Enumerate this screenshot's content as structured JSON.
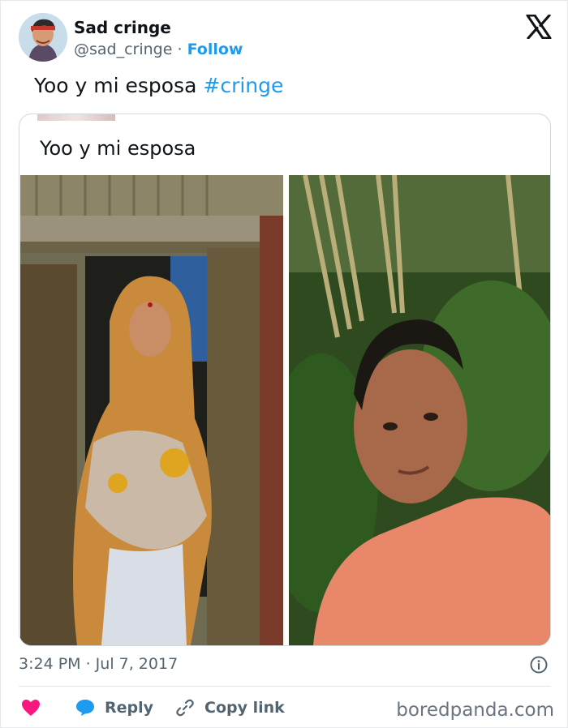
{
  "author": {
    "display_name": "Sad cringe",
    "handle": "@sad_cringe",
    "separator": "·",
    "follow_label": "Follow"
  },
  "tweet": {
    "text": "Yoo y mi esposa",
    "hashtag": "#cringe"
  },
  "quoted": {
    "text": "Yoo y mi esposa"
  },
  "meta": {
    "timestamp": "3:24 PM · Jul 7, 2017"
  },
  "actions": {
    "like_icon": "heart-icon",
    "reply_label": "Reply",
    "copy_label": "Copy link"
  },
  "watermark": "boredpanda.com",
  "colors": {
    "accent": "#1d9bf0",
    "like": "#f91880",
    "muted": "#536471"
  }
}
